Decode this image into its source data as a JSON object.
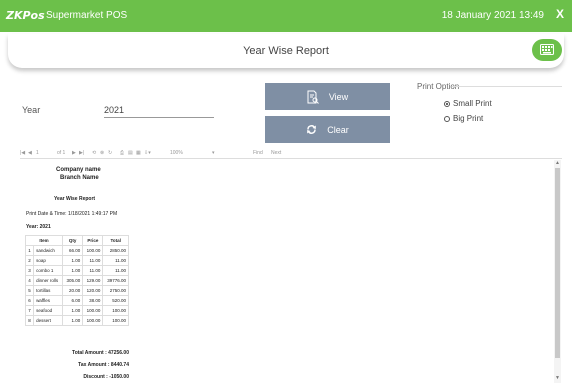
{
  "app": {
    "logo": "ZKPos",
    "name": "Supermarket POS",
    "datetime": "18 January 2021 13:49",
    "close": "X"
  },
  "page": {
    "title": "Year Wise Report"
  },
  "form": {
    "year_label": "Year",
    "year_value": "2021",
    "view_label": "View",
    "clear_label": "Clear",
    "print_option_title": "Print Option",
    "small_print_label": "Small Print",
    "big_print_label": "Big Print",
    "selected_print": "Small Print"
  },
  "toolbar": {
    "page": "1",
    "of_pages": "of 1",
    "zoom": "100%",
    "find": "Find",
    "next": "Next"
  },
  "report": {
    "company": "Company name",
    "branch": "Branch Name",
    "title": "Year Wise Report",
    "print_date": "Print Date & Time: 1/18/2021 1:49:17 PM",
    "year": "Year: 2021",
    "columns": [
      "Item",
      "Qty",
      "Price",
      "Total"
    ],
    "rows": [
      {
        "no": "1",
        "item": "sandwich",
        "qty": "66.00",
        "price": "100.00",
        "total": "2850.00"
      },
      {
        "no": "2",
        "item": "soap",
        "qty": "1.00",
        "price": "11.00",
        "total": "11.00"
      },
      {
        "no": "3",
        "item": "combo 1",
        "qty": "1.00",
        "price": "11.00",
        "total": "11.00"
      },
      {
        "no": "4",
        "item": "dinner rolls",
        "qty": "305.00",
        "price": "129.00",
        "total": "39776.00"
      },
      {
        "no": "5",
        "item": "tortillas",
        "qty": "20.00",
        "price": "120.00",
        "total": "2750.00"
      },
      {
        "no": "6",
        "item": "waffles",
        "qty": "6.00",
        "price": "38.00",
        "total": "520.00"
      },
      {
        "no": "7",
        "item": "seafood",
        "qty": "1.00",
        "price": "100.00",
        "total": "100.00"
      },
      {
        "no": "8",
        "item": "dessert",
        "qty": "1.00",
        "price": "100.00",
        "total": "100.00"
      }
    ],
    "total_amount_label": "Total Amount :",
    "total_amount": "47256.00",
    "tax_amount_label": "Tax Amount :",
    "tax_amount": "8440.74",
    "discount_label": "Discount :",
    "discount": "-1050.00"
  },
  "colors": {
    "brand_green": "#6cc04a",
    "button_gray": "#7f8fa4"
  },
  "icons": {
    "keyboard": "keyboard-icon",
    "view": "document-search-icon",
    "clear": "refresh-icon"
  }
}
